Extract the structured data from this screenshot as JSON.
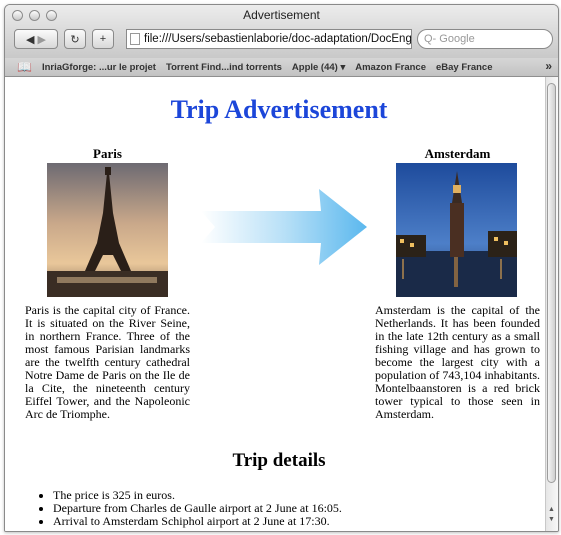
{
  "browser": {
    "window_title": "Advertisement",
    "url": "file:///Users/sebastienlaborie/doc-adaptation/DocEngC",
    "search_placeholder": "Q- Google",
    "bookmarks": [
      "InriaGforge: ...ur le projet",
      "Torrent Find...ind torrents",
      "Apple (44) ▾",
      "Amazon France",
      "eBay France"
    ],
    "more_label": "»"
  },
  "page": {
    "title": "Trip Advertisement",
    "origin": {
      "name": "Paris",
      "description": "Paris is the capital city of France. It is situated on the River Seine, in northern France. Three of the most famous Parisian landmarks are the twelfth century cathedral Notre Dame de Paris on the Ile de la Cite, the nineteenth century Eiffel Tower, and the Napoleonic Arc de Triomphe."
    },
    "destination": {
      "name": "Amsterdam",
      "description": "Amsterdam is the capital of the Netherlands. It has been founded in the late 12th century as a small fishing village and has grown to become the largest city with a population of 743,104 inhabitants. Montelbaanstoren is a red brick tower typical to those seen in Amsterdam."
    },
    "details_heading": "Trip details",
    "details": [
      "The price is 325 in euros.",
      "Departure from Charles de Gaulle airport at 2 June at 16:05.",
      "Arrival to Amsterdam Schiphol airport at 2 June at 17:30."
    ]
  },
  "colors": {
    "title": "#1c46d9",
    "arrow": "#5bb8ee"
  }
}
